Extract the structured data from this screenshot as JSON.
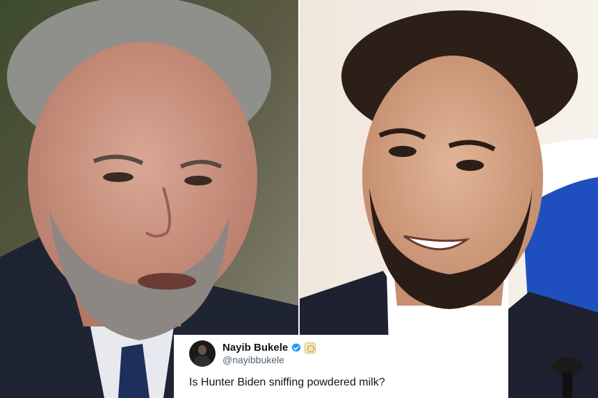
{
  "photos": {
    "left": {
      "description_icon": "person-photo-icon"
    },
    "right": {
      "description_icon": "person-photo-icon"
    }
  },
  "tweet": {
    "display_name": "Nayib Bukele",
    "handle": "@nayibbukele",
    "text": "Is Hunter Biden sniffing powdered milk?",
    "icons": [
      "verified-badge-icon",
      "affiliate-badge-icon"
    ]
  },
  "colors": {
    "verified": "#1d9bf0",
    "name_text": "#0f1419",
    "handle_text": "#536471"
  }
}
